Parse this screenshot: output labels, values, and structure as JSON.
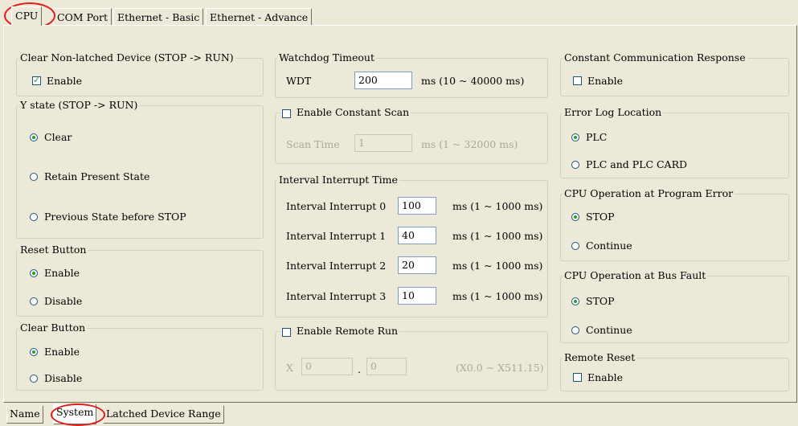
{
  "top_tabs": [
    "CPU",
    "COM Port",
    "Ethernet - Basic",
    "Ethernet - Advance"
  ],
  "bottom_tabs": [
    "Name",
    "System",
    "Latched Device Range"
  ],
  "clear_nonlatched": {
    "title": "Clear Non-latched Device (STOP -> RUN)",
    "enable_label": "Enable",
    "checked": true
  },
  "y_state": {
    "title": "Y state (STOP -> RUN)",
    "options": [
      "Clear",
      "Retain Present State",
      "Previous State before STOP"
    ],
    "selected": "Clear"
  },
  "reset_button": {
    "title": "Reset Button",
    "options": [
      "Enable",
      "Disable"
    ],
    "selected": "Enable"
  },
  "clear_button": {
    "title": "Clear Button",
    "options": [
      "Enable",
      "Disable"
    ],
    "selected": "Enable"
  },
  "watchdog": {
    "title": "Watchdog Timeout",
    "label": "WDT",
    "value": "200",
    "range": "ms (10 ~ 40000 ms)"
  },
  "constant_scan": {
    "title": "Enable Constant Scan",
    "checked": false,
    "label": "Scan Time",
    "value": "1",
    "range": "ms (1 ~ 32000 ms)"
  },
  "interval_interrupt": {
    "title": "Interval Interrupt Time",
    "items": [
      {
        "label": "Interval Interrupt 0",
        "value": "100",
        "range": "ms (1 ~ 1000 ms)"
      },
      {
        "label": "Interval Interrupt 1",
        "value": "40",
        "range": "ms (1 ~ 1000 ms)"
      },
      {
        "label": "Interval Interrupt 2",
        "value": "20",
        "range": "ms (1 ~ 1000 ms)"
      },
      {
        "label": "Interval Interrupt 3",
        "value": "10",
        "range": "ms (1 ~ 1000 ms)"
      }
    ]
  },
  "remote_run": {
    "title": "Enable Remote Run",
    "checked": false,
    "prefix": "X",
    "value1": "0",
    "separator": ".",
    "value2": "0",
    "range": "(X0.0 ~ X511.15)"
  },
  "constant_comm": {
    "title": "Constant Communication Response",
    "enable_label": "Enable",
    "checked": false
  },
  "error_log": {
    "title": "Error Log Location",
    "options": [
      "PLC",
      "PLC and PLC CARD"
    ],
    "selected": "PLC"
  },
  "program_error": {
    "title": "CPU Operation at Program Error",
    "options": [
      "STOP",
      "Continue"
    ],
    "selected": "STOP"
  },
  "bus_fault": {
    "title": "CPU Operation at Bus Fault",
    "options": [
      "STOP",
      "Continue"
    ],
    "selected": "STOP"
  },
  "remote_reset": {
    "title": "Remote Reset",
    "enable_label": "Enable",
    "checked": false
  },
  "colors": {
    "background": "#ECE9D8",
    "highlight": "#E01B1B",
    "check": "#21A121"
  }
}
